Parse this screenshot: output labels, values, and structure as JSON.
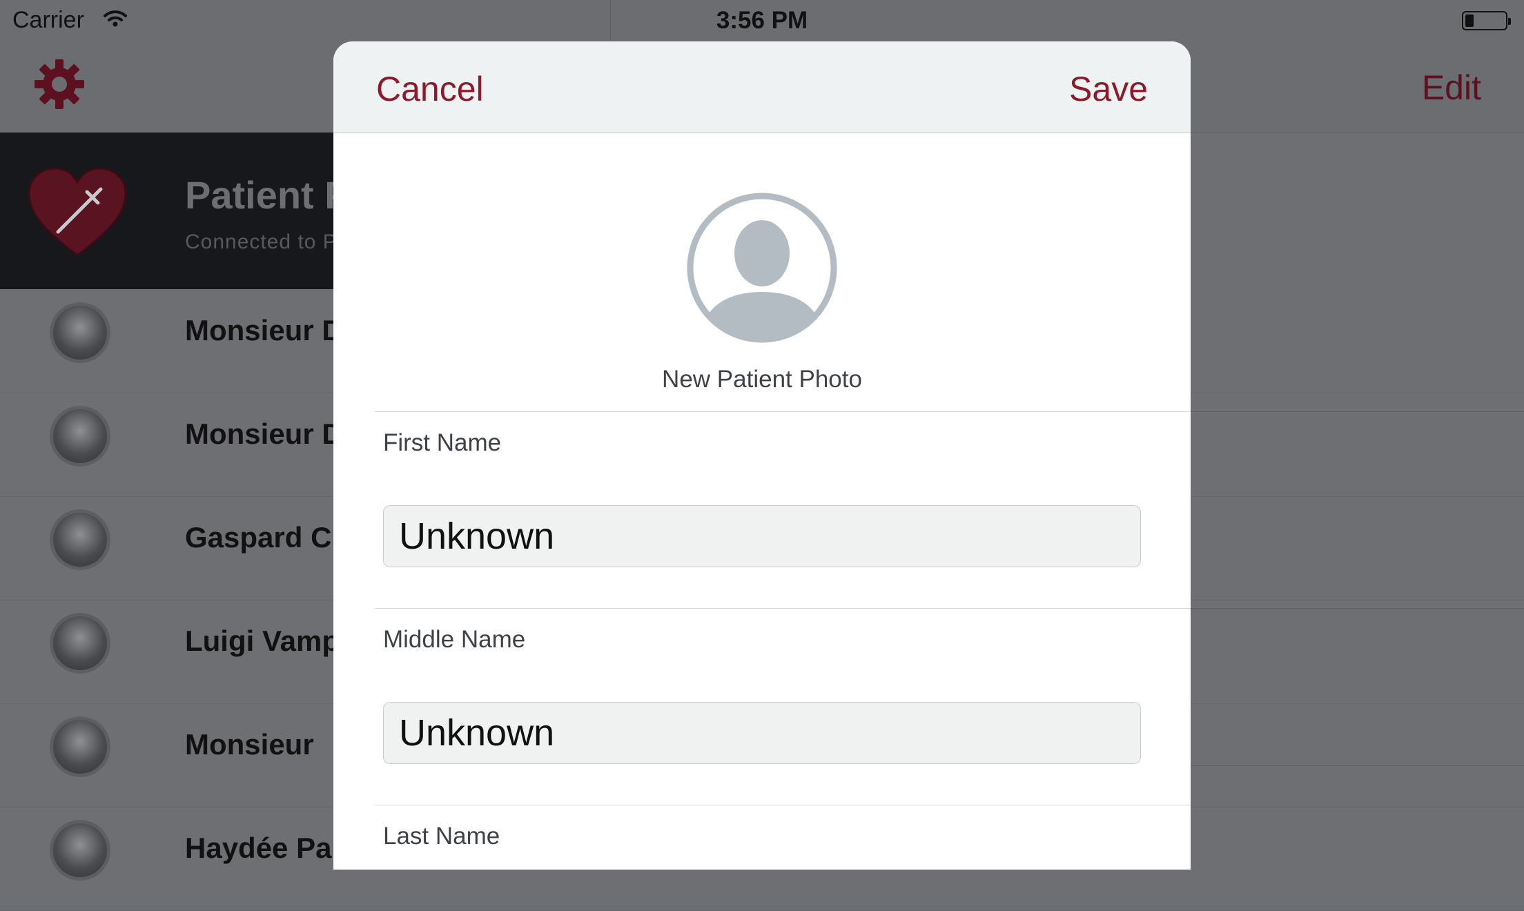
{
  "status_bar": {
    "carrier": "Carrier",
    "time": "3:56 PM"
  },
  "nav": {
    "settings_icon": "gear-icon",
    "edit_label": "Edit"
  },
  "list_header": {
    "title": "Patient P",
    "subtitle": "Connected to P",
    "icon": "heart-syringe-icon"
  },
  "patients": [
    {
      "name": "Monsieur D"
    },
    {
      "name": "Monsieur D"
    },
    {
      "name": "Gaspard C"
    },
    {
      "name": "Luigi Vamp"
    },
    {
      "name": "Monsieur"
    },
    {
      "name": "Haydée Pa"
    }
  ],
  "modal": {
    "cancel_label": "Cancel",
    "save_label": "Save",
    "photo_icon": "person-placeholder-icon",
    "photo_label": "New Patient Photo",
    "fields": [
      {
        "label": "First Name",
        "value": "Unknown"
      },
      {
        "label": "Middle Name",
        "value": "Unknown"
      },
      {
        "label": "Last Name",
        "value": ""
      }
    ]
  },
  "colors": {
    "accent": "#8d1a2b",
    "accent_dimmed": "#5c1020",
    "header_bg": "#eff2f2",
    "dim_overlay": "#6e6f72"
  }
}
